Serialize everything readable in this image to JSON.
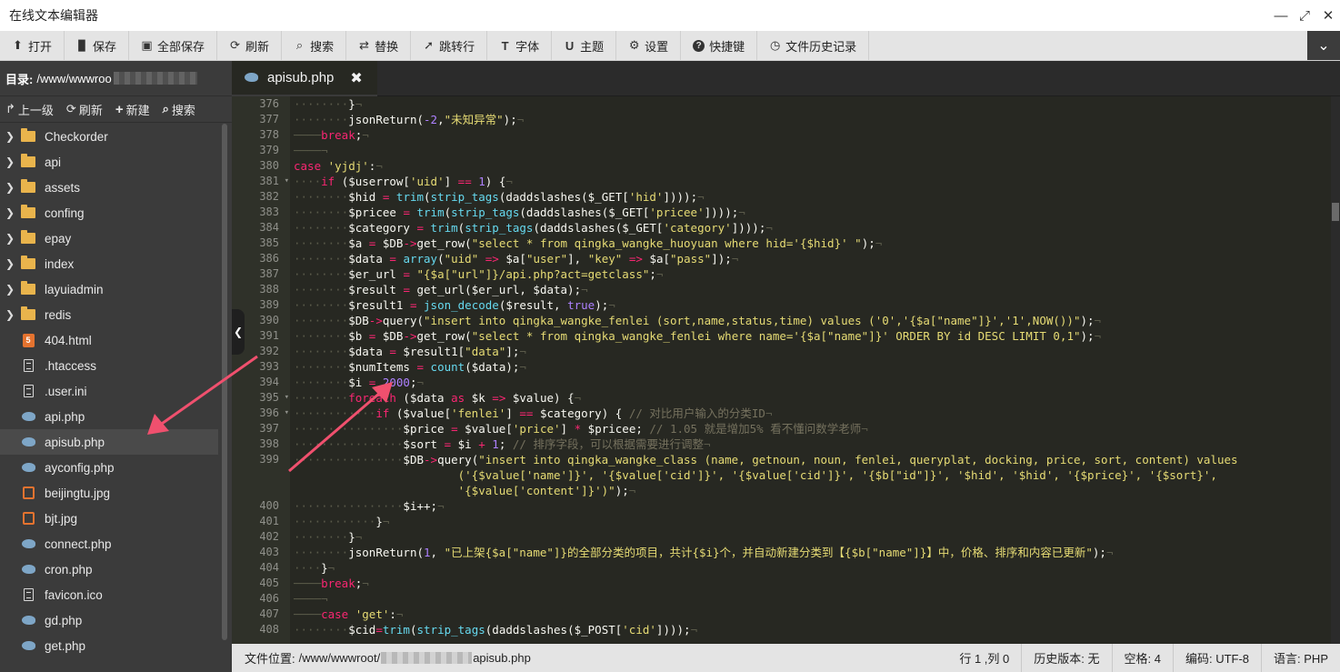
{
  "window": {
    "title": "在线文本编辑器",
    "buttons": [
      "—",
      "⤢",
      "✕"
    ]
  },
  "toolbar": {
    "items": [
      {
        "icon": "upload-icon",
        "glyph": "⬆",
        "label": "打开"
      },
      {
        "icon": "save-icon",
        "glyph": "💾",
        "label": "保存"
      },
      {
        "icon": "save-all-icon",
        "glyph": "▣",
        "label": "全部保存"
      },
      {
        "icon": "refresh-icon",
        "glyph": "⟳",
        "label": "刷新"
      },
      {
        "icon": "search-icon",
        "glyph": "🔍",
        "label": "搜索"
      },
      {
        "icon": "replace-icon",
        "glyph": "⇄",
        "label": "替换"
      },
      {
        "icon": "goto-icon",
        "glyph": "➚",
        "label": "跳转行"
      },
      {
        "icon": "font-icon",
        "glyph": "T",
        "label": "字体"
      },
      {
        "icon": "theme-icon",
        "glyph": "U",
        "label": "主题"
      },
      {
        "icon": "gear-icon",
        "glyph": "⚙",
        "label": "设置"
      },
      {
        "icon": "help-icon",
        "glyph": "?",
        "label": "快捷键"
      },
      {
        "icon": "history-icon",
        "glyph": "◷",
        "label": "文件历史记录"
      }
    ],
    "collapse": "⌄"
  },
  "sidebar": {
    "dir_label": "目录:",
    "dir_path": "/www/wwwroo",
    "dir_path_tail": "",
    "actions": [
      {
        "icon": "up-icon",
        "glyph": "↱",
        "label": "上一级"
      },
      {
        "icon": "refresh-icon",
        "glyph": "⟳",
        "label": "刷新"
      },
      {
        "icon": "plus-icon",
        "glyph": "+",
        "label": "新建"
      },
      {
        "icon": "search-icon",
        "glyph": "⌕",
        "label": "搜索"
      }
    ],
    "files": [
      {
        "name": "Checkorder",
        "type": "folder"
      },
      {
        "name": "api",
        "type": "folder"
      },
      {
        "name": "assets",
        "type": "folder"
      },
      {
        "name": "confing",
        "type": "folder"
      },
      {
        "name": "epay",
        "type": "folder"
      },
      {
        "name": "index",
        "type": "folder"
      },
      {
        "name": "layuiadmin",
        "type": "folder"
      },
      {
        "name": "redis",
        "type": "folder"
      },
      {
        "name": "404.html",
        "type": "html"
      },
      {
        "name": ".htaccess",
        "type": "doc"
      },
      {
        "name": ".user.ini",
        "type": "doc"
      },
      {
        "name": "api.php",
        "type": "php"
      },
      {
        "name": "apisub.php",
        "type": "php",
        "active": true
      },
      {
        "name": "ayconfig.php",
        "type": "php"
      },
      {
        "name": "beijingtu.jpg",
        "type": "img"
      },
      {
        "name": "bjt.jpg",
        "type": "img"
      },
      {
        "name": "connect.php",
        "type": "php"
      },
      {
        "name": "cron.php",
        "type": "php"
      },
      {
        "name": "favicon.ico",
        "type": "doc"
      },
      {
        "name": "gd.php",
        "type": "php"
      },
      {
        "name": "get.php",
        "type": "php"
      }
    ]
  },
  "editor": {
    "tab": {
      "name": "apisub.php",
      "close": "✖"
    },
    "line_numbers": [
      "376",
      "377",
      "378",
      "379",
      "380",
      "381",
      "382",
      "383",
      "384",
      "385",
      "386",
      "387",
      "388",
      "389",
      "390",
      "391",
      "392",
      "393",
      "394",
      "395",
      "396",
      "397",
      "398",
      "399",
      "",
      "",
      "400",
      "401",
      "402",
      "403",
      "404",
      "405",
      "406",
      "407",
      "408"
    ],
    "fold_lines": [
      "381",
      "395",
      "396"
    ]
  },
  "statusbar": {
    "path_label": "文件位置:",
    "path_prefix": "/www/wwwroot/",
    "path_file": "apisub.php",
    "position": "行 1 ,列 0",
    "history": "历史版本: 无",
    "indent": "空格: 4",
    "encoding": "编码: UTF-8",
    "language": "语言: PHP"
  },
  "colors": {
    "editor_bg": "#272822",
    "keyword": "#f92672",
    "string": "#e6db74",
    "function": "#66d9ef",
    "number": "#ae81ff",
    "comment": "#75715e",
    "arrow": "#f0506e"
  }
}
